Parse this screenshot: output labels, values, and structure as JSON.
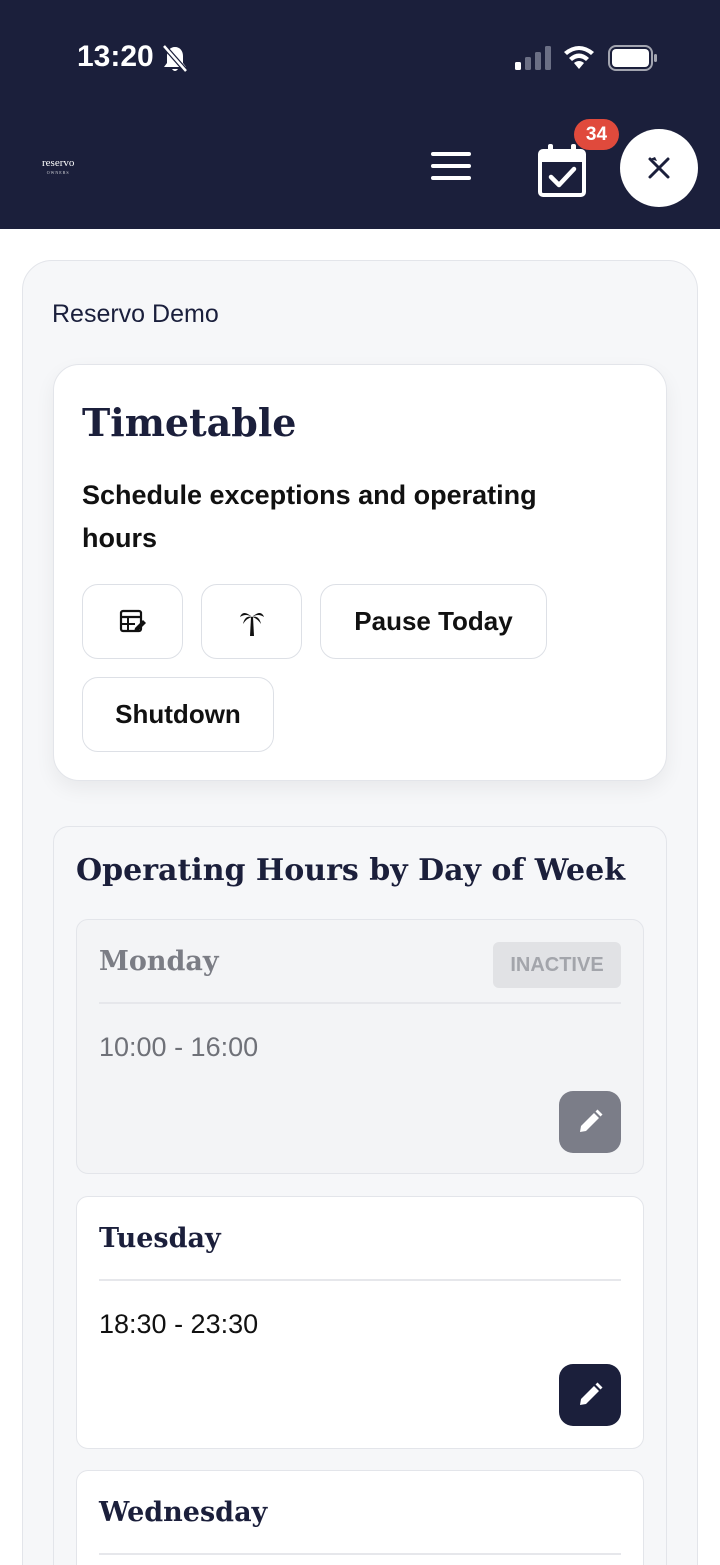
{
  "status_bar": {
    "time": "13:20"
  },
  "header": {
    "logo_text": "reservo",
    "logo_sub": "OWNERS",
    "badge_count": "34"
  },
  "venue": {
    "name": "Reservo Demo"
  },
  "timetable": {
    "title": "Timetable",
    "subtitle": "Schedule exceptions and operating hours",
    "pause_today_label": "Pause Today",
    "shutdown_label": "Shutdown"
  },
  "operating_hours": {
    "title": "Operating Hours by Day of Week",
    "days": [
      {
        "name": "Monday",
        "hours": "10:00 - 16:00",
        "status": "INACTIVE"
      },
      {
        "name": "Tuesday",
        "hours": "18:30 - 23:30",
        "status": ""
      },
      {
        "name": "Wednesday",
        "hours": "",
        "status": ""
      }
    ]
  },
  "colors": {
    "header_bg": "#1b1f3b",
    "badge": "#e04a3c",
    "edit_active": "#1b1f3b",
    "edit_inactive": "#7b7d88"
  }
}
